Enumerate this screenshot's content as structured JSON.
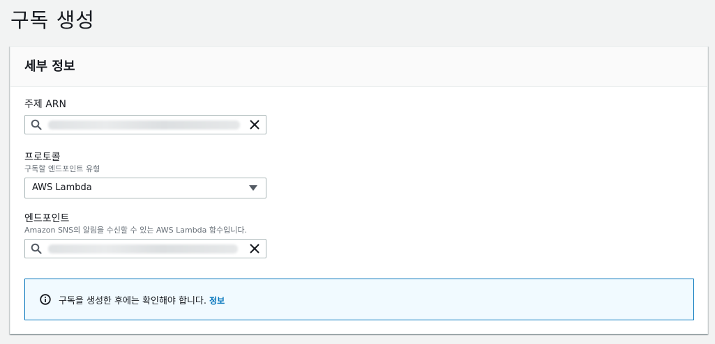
{
  "page": {
    "title": "구독 생성"
  },
  "details": {
    "heading": "세부 정보",
    "topic_arn": {
      "label": "주제 ARN",
      "value_redacted": true
    },
    "protocol": {
      "label": "프로토콜",
      "description": "구독할 엔드포인트 유형",
      "selected": "AWS Lambda"
    },
    "endpoint": {
      "label": "엔드포인트",
      "description": "Amazon SNS의 알림을 수신할 수 있는 AWS Lambda 함수입니다.",
      "value_redacted": true
    },
    "info": {
      "message": "구독을 생성한 후에는 확인해야 합니다.",
      "link": "정보"
    }
  },
  "colors": {
    "accent": "#0073bb",
    "info_background": "#f1faff",
    "page_background": "#f2f3f3"
  },
  "icons": [
    "search-icon",
    "clear-icon",
    "caret-down-icon",
    "info-icon"
  ]
}
